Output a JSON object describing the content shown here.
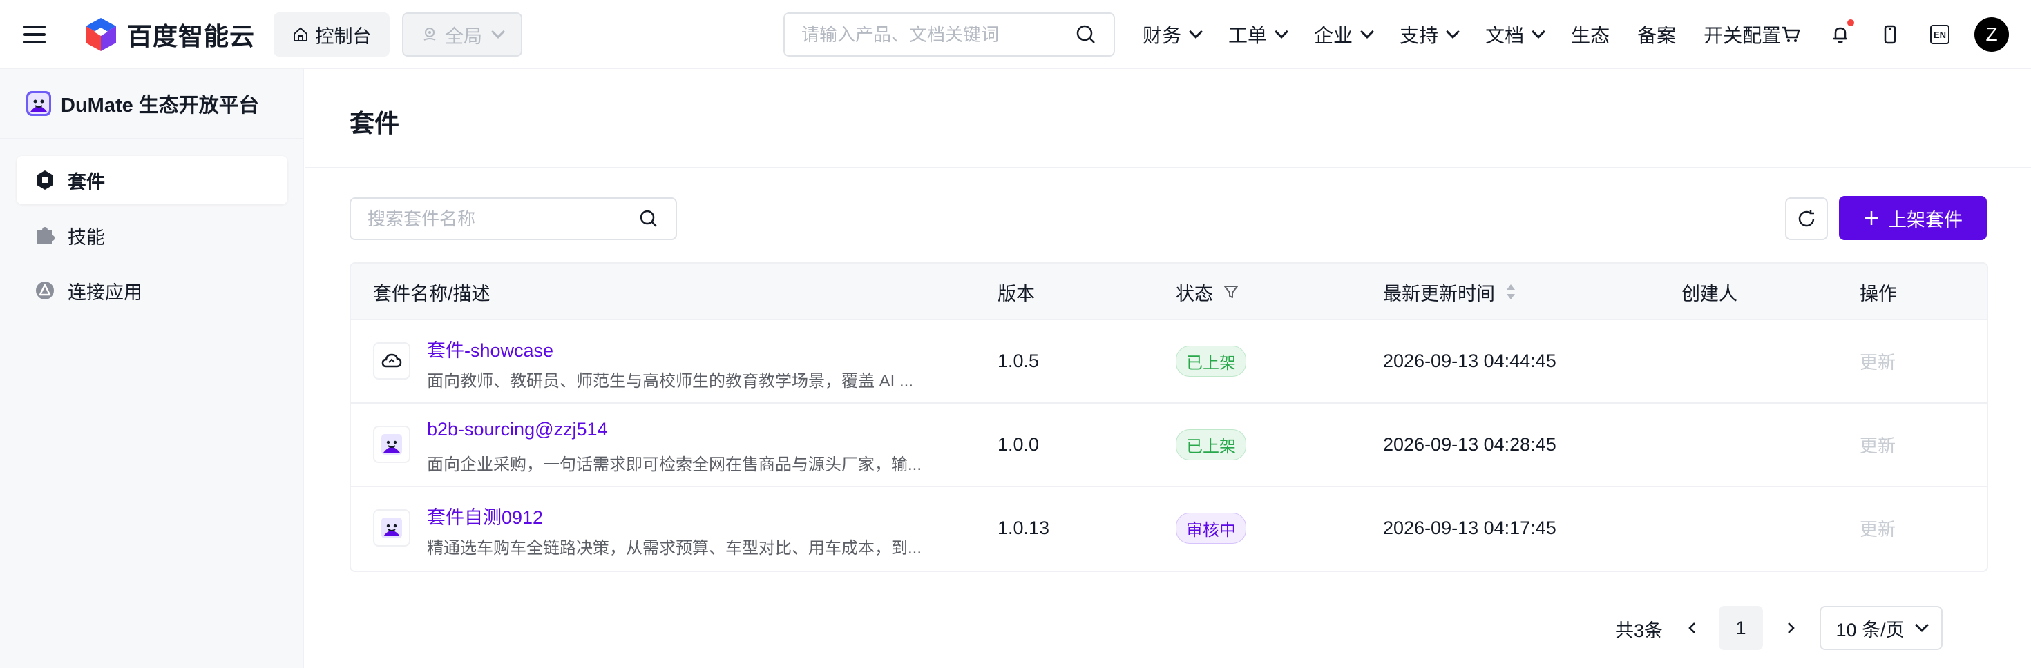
{
  "topnav": {
    "logo_text": "百度智能云",
    "console_label": "控制台",
    "region_label": "全局",
    "search_placeholder": "请输入产品、文档关键词",
    "links": [
      {
        "label": "财务",
        "has_dropdown": true
      },
      {
        "label": "工单",
        "has_dropdown": true
      },
      {
        "label": "企业",
        "has_dropdown": true
      },
      {
        "label": "支持",
        "has_dropdown": true
      },
      {
        "label": "文档",
        "has_dropdown": true
      },
      {
        "label": "生态",
        "has_dropdown": false
      },
      {
        "label": "备案",
        "has_dropdown": false
      },
      {
        "label": "开关配置",
        "has_dropdown": false
      }
    ],
    "icons": [
      "cart-icon",
      "bell-icon",
      "mobile-icon",
      "language-en-icon"
    ],
    "lang_label": "EN",
    "avatar_letter": "Z"
  },
  "sidebar": {
    "title": "DuMate 生态开放平台",
    "items": [
      {
        "label": "套件",
        "icon": "suite-icon",
        "active": true
      },
      {
        "label": "技能",
        "icon": "puzzle-icon",
        "active": false
      },
      {
        "label": "连接应用",
        "icon": "connect-app-icon",
        "active": false
      }
    ]
  },
  "main": {
    "title": "套件",
    "search_placeholder": "搜索套件名称",
    "add_button": "上架套件",
    "table": {
      "columns": [
        "套件名称/描述",
        "版本",
        "状态",
        "最新更新时间",
        "创建人",
        "操作"
      ],
      "rows": [
        {
          "name": "套件-showcase",
          "desc": "面向教师、教研员、师范生与高校师生的教育教学场景，覆盖 AI ...",
          "version": "1.0.5",
          "status": "已上架",
          "status_type": "green",
          "updated": "2026-09-13 04:44:45",
          "creator": "",
          "action": "更新",
          "icon": "cloud-suite-icon"
        },
        {
          "name": "b2b-sourcing@zzj514",
          "desc": "面向企业采购，一句话需求即可检索全网在售商品与源头厂家，输...",
          "version": "1.0.0",
          "status": "已上架",
          "status_type": "green",
          "updated": "2026-09-13 04:28:45",
          "creator": "",
          "action": "更新",
          "icon": "dumate-icon"
        },
        {
          "name": "套件自测0912",
          "desc": "精通选车购车全链路决策，从需求预算、车型对比、用车成本，到...",
          "version": "1.0.13",
          "status": "审核中",
          "status_type": "purple",
          "updated": "2026-09-13 04:17:45",
          "creator": "",
          "action": "更新",
          "icon": "dumate-icon"
        }
      ]
    },
    "pagination": {
      "total_label": "共3条",
      "current_page": "1",
      "page_size_label": "10 条/页"
    }
  },
  "colors": {
    "accent": "#5c09e6",
    "tag_green": "#29a84b",
    "notification_dot": "#f5423f"
  }
}
